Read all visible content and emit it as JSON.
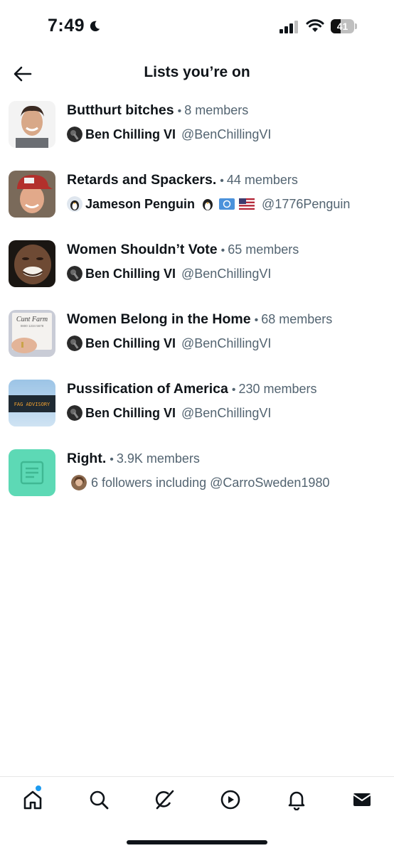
{
  "status_bar": {
    "time": "7:49",
    "battery_level": "41",
    "battery_fraction": 0.41,
    "icons": [
      "moon-icon",
      "signal-icon",
      "wifi-icon",
      "battery-icon"
    ]
  },
  "header": {
    "title": "Lists you’re on",
    "back_icon": "arrow-left-icon"
  },
  "lists": [
    {
      "name": "Butthurt bitches",
      "members": "8 members",
      "owner_name": "Ben Chilling VI",
      "owner_handle": "@BenChillingVI"
    },
    {
      "name": "Retards and Spackers.",
      "members": "44 members",
      "owner_name": "Jameson Penguin",
      "owner_handle": "@1776Penguin",
      "owner_badges": [
        "penguin-emoji",
        "un-flag-emoji",
        "us-flag-emoji"
      ]
    },
    {
      "name": "Women Shouldn’t Vote",
      "members": "65 members",
      "owner_name": "Ben Chilling VI",
      "owner_handle": "@BenChillingVI"
    },
    {
      "name": "Women Belong in the Home",
      "members": "68 members",
      "owner_name": "Ben Chilling VI",
      "owner_handle": "@BenChillingVI",
      "thumb_text": "Cunt Farm",
      "thumb_subtext": "0800 1234 5678"
    },
    {
      "name": "Pussification of America",
      "members": "230 members",
      "owner_name": "Ben Chilling VI",
      "owner_handle": "@BenChillingVI",
      "thumb_text": "FAG ADVISORY"
    },
    {
      "name": "Right.",
      "members": "3.9K members",
      "followers_text": "6 followers including @CarroSweden1980",
      "thumb_icon": "list-document-icon"
    }
  ],
  "bottom_nav": {
    "items": [
      "home-icon",
      "search-icon",
      "grok-icon",
      "play-icon",
      "bell-icon",
      "mail-icon"
    ],
    "accent": "#1d9bf0"
  },
  "colors": {
    "text": "#0f1419",
    "secondary": "#536471",
    "right_list_thumb": "#5dd9b5"
  }
}
